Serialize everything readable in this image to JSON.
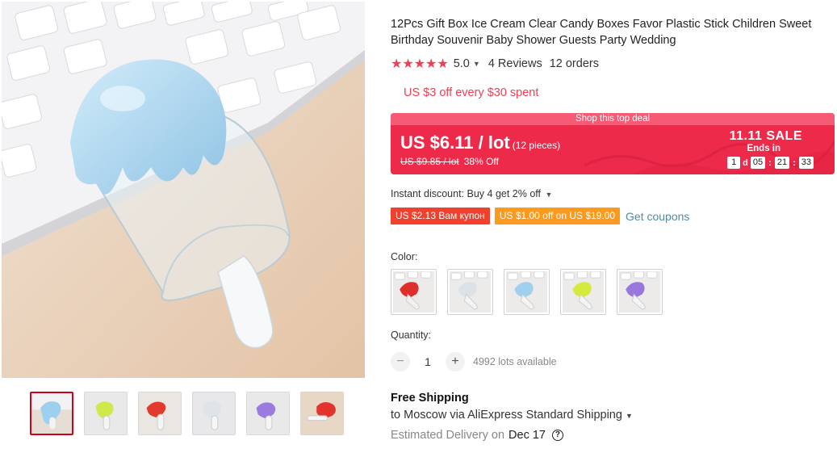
{
  "product": {
    "title": "12Pcs Gift Box Ice Cream Clear Candy Boxes Favor Plastic Stick Children Sweet Birthday Souvenir Baby Shower Guests Party Wedding",
    "rating": "5.0",
    "stars": "★★★★★",
    "reviews": "4 Reviews",
    "orders": "12 orders"
  },
  "store_discount": "US $3 off every $30 spent",
  "deal": {
    "header": "Shop this top deal",
    "price": "US $6.11 / lot",
    "pieces": "(12 pieces)",
    "old_price": "US $9.85 / lot",
    "discount": "38% Off",
    "sale_label": "11.11 SALE",
    "ends_in": "Ends in",
    "timer": {
      "days": "1",
      "d": "d",
      "hours": "05",
      "minutes": "21",
      "seconds": "33",
      "sep": ":"
    }
  },
  "instant_discount": "Instant discount: Buy 4 get 2% off",
  "coupons": [
    "US $2.13 Вам купон",
    "US $1.00 off on US $19.00"
  ],
  "get_coupons": "Get coupons",
  "color_label": "Color:",
  "colors": [
    "red",
    "white",
    "blue",
    "green",
    "purple"
  ],
  "quantity": {
    "label": "Quantity:",
    "minus": "−",
    "value": "1",
    "plus": "+",
    "available": "4992 lots available"
  },
  "shipping": {
    "title": "Free Shipping",
    "detail": "to Moscow via AliExpress Standard Shipping",
    "estimated_label": "Estimated Delivery on",
    "date": "Dec 17"
  },
  "colors_hex": {
    "accent": "#f33d52",
    "deal_bg": "#ee2a4a",
    "coupon_red": "#f0402e",
    "coupon_orange": "#fb9a1c",
    "link": "#4f8ca4"
  }
}
